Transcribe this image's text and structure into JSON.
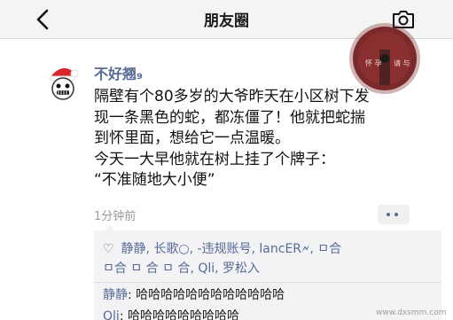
{
  "nav": {
    "title": "朋友圈",
    "back_icon": "chevron-left-icon",
    "camera_icon": "camera-icon"
  },
  "floating_badge": {
    "left_text": "怀 孕",
    "right_text": "请 与"
  },
  "post": {
    "username": "不好翘₉",
    "lines": [
      "隔壁有个80多岁的大爷昨天在小区树下发",
      "现一条黑色的蛇，都冻僵了！他就把蛇揣",
      "到怀里面，想给它一点温暖。",
      "今天一大早他就在树上挂了个牌子：",
      "“不准随地大小便”"
    ],
    "time": "1分钟前"
  },
  "likes": {
    "line1": "静静, 长歌○, -违规账号, lancER🗲, ㅁ合",
    "line2": "ㅁ合 ㅁ 合  ㅁ 合, Qli, 罗松入"
  },
  "comments": [
    {
      "author": "静静",
      "text": "哈哈哈哈哈哈哈哈哈哈哈哈"
    },
    {
      "author": "Qli",
      "text": "哈哈哈哈哈哈哈哈哈"
    }
  ],
  "watermark": "www.dxsmm.com",
  "colors": {
    "link_blue": "#576b95",
    "badge_red": "#7a2a2a"
  }
}
